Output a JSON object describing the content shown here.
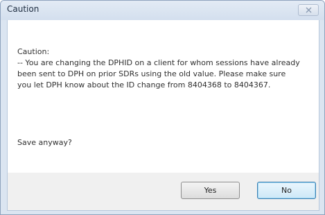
{
  "window": {
    "title": "Caution",
    "close_icon": "close-icon"
  },
  "message": {
    "heading": "Caution:",
    "body": "-- You are changing the DPHID on a client for whom sessions have already been sent to DPH on prior SDRs using the old value. Please make sure you let DPH know about the ID change from 8404368 to 8404367.",
    "question": "Save anyway?"
  },
  "buttons": {
    "yes_label": "Yes",
    "no_label": "No"
  },
  "colors": {
    "titlebar": "#d9e4f1",
    "default_button_border": "#3c7fb1"
  }
}
